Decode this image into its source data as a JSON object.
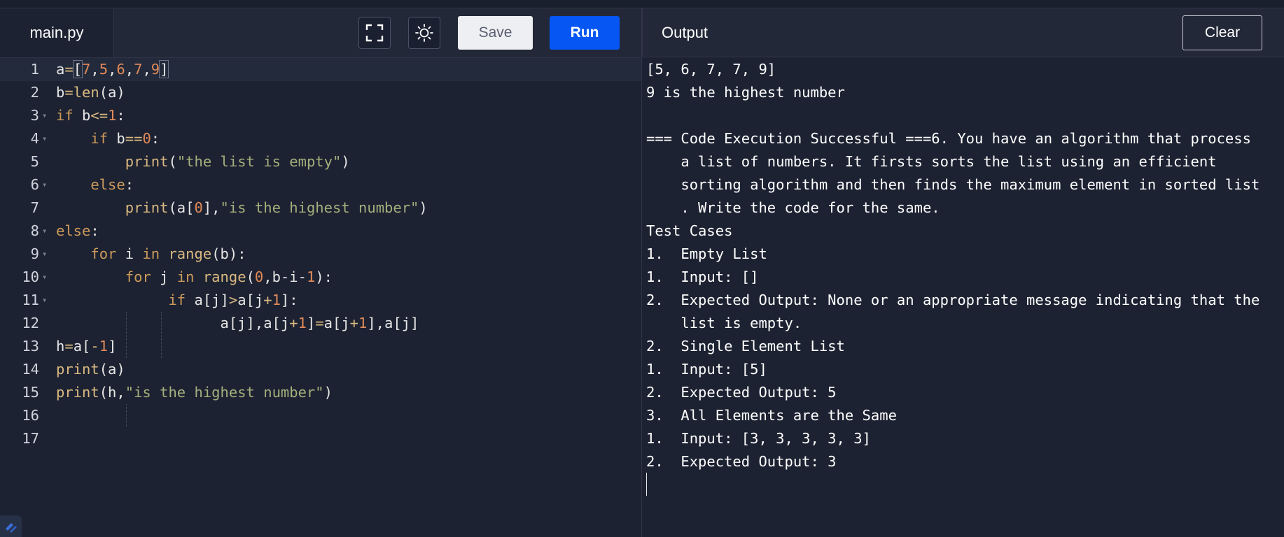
{
  "editor": {
    "file_name": "main.py",
    "save_label": "Save",
    "run_label": "Run",
    "lines": [
      "1",
      "2",
      "3",
      "4",
      "5",
      "6",
      "7",
      "8",
      "9",
      "10",
      "11",
      "12",
      "13",
      "14",
      "15",
      "16",
      "17"
    ],
    "code": {
      "l1": {
        "a": "a",
        "eq": "=",
        "lb": "[",
        "n1": "7",
        "c1": ",",
        "n2": "5",
        "c2": ",",
        "n3": "6",
        "c3": ",",
        "n4": "7",
        "c4": ",",
        "n5": "9",
        "rb": "]"
      },
      "l2": {
        "b": "b",
        "eq": "=",
        "fn": "len",
        "rest": "(a)"
      },
      "l3": {
        "kw": "if",
        "v": " b",
        "op": "<=",
        "n": "1",
        "c": ":"
      },
      "l4": {
        "kw": "if",
        "v": " b",
        "op": "==",
        "n": "0",
        "c": ":"
      },
      "l5": {
        "fn": "print",
        "p": "(",
        "s": "\"the list is empty\"",
        "e": ")"
      },
      "l6": {
        "kw": "else",
        "c": ":"
      },
      "l7": {
        "fn": "print",
        "p": "(a[",
        "n": "0",
        "m": "],",
        "s": "\"is the highest number\"",
        "e": ")"
      },
      "l8": {
        "kw": "else",
        "c": ":"
      },
      "l9": {
        "kw": "for",
        "v": " i ",
        "kw2": "in",
        "fn": " range",
        "rest": "(b):"
      },
      "l10": {
        "kw": "for",
        "v": " j ",
        "kw2": "in",
        "fn": " range",
        "p": "(",
        "n": "0",
        "m": ",b-i-",
        "n2": "1",
        "e": "):"
      },
      "l11": {
        "kw": "if",
        "v": " a[j]",
        "op": ">",
        "m": "a[j",
        "op2": "+",
        "n": "1",
        "e": "]:"
      },
      "l12": {
        "a": "a[j],a[j",
        "op": "+",
        "n": "1",
        "m": "]",
        "eq": "=",
        "b": "a[j",
        "op2": "+",
        "n2": "1",
        "e": "],a[j]"
      },
      "l13": {
        "v": "h",
        "eq": "=",
        "m": "a[",
        "op": "-",
        "n": "1",
        "e": "]"
      },
      "l14": {
        "fn": "print",
        "rest": "(a)"
      },
      "l15": {
        "fn": "print",
        "p": "(h,",
        "s": "\"is the highest number\"",
        "e": ")"
      }
    }
  },
  "output": {
    "title": "Output",
    "clear_label": "Clear",
    "lines": [
      "[5, 6, 7, 7, 9]",
      "9 is the highest number",
      "",
      "=== Code Execution Successful ===6. You have an algorithm that process",
      "    a list of numbers. It firsts sorts the list using an efficient",
      "    sorting algorithm and then finds the maximum element in sorted list",
      "    . Write the code for the same.",
      "Test Cases",
      "1.  Empty List",
      "1.  Input: []",
      "2.  Expected Output: None or an appropriate message indicating that the",
      "    list is empty.",
      "2.  Single Element List",
      "1.  Input: [5]",
      "2.  Expected Output: 5",
      "3.  All Elements are the Same",
      "1.  Input: [3, 3, 3, 3, 3]",
      "2.  Expected Output: 3"
    ]
  },
  "icons": {
    "fullscreen": "fullscreen-icon",
    "theme": "sun-icon",
    "logo": "app-logo-icon"
  },
  "colors": {
    "run_button": "#0556f3",
    "background": "#1d2232",
    "keyword": "#cc9a5a",
    "number": "#e08a59",
    "string": "#a2b07c"
  }
}
